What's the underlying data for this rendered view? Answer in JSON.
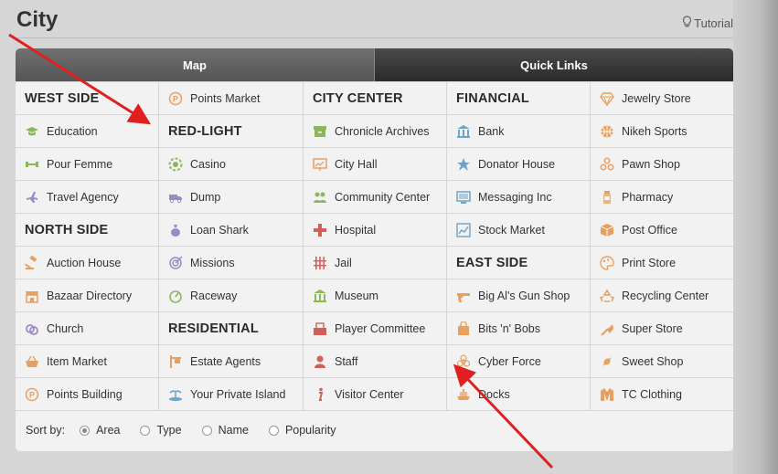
{
  "header": {
    "title": "City",
    "tutorial": "Tutorial"
  },
  "tabs": [
    {
      "label": "Map"
    },
    {
      "label": "Quick Links"
    }
  ],
  "colors": {
    "icon_orange": "#e8a060",
    "icon_green": "#8db85a",
    "icon_blue": "#6fa3c7",
    "icon_purple": "#9b8ac4",
    "icon_red": "#d0605a",
    "arrow": "#e02020"
  },
  "columns": [
    [
      {
        "type": "head",
        "label": "WEST SIDE"
      },
      {
        "type": "link",
        "label": "Education",
        "icon": "graduation-cap-icon",
        "color": "#8db85a"
      },
      {
        "type": "link",
        "label": "Pour Femme",
        "icon": "dumbbell-icon",
        "color": "#8db85a"
      },
      {
        "type": "link",
        "label": "Travel Agency",
        "icon": "airplane-icon",
        "color": "#9b8ac4"
      },
      {
        "type": "head",
        "label": "NORTH SIDE"
      },
      {
        "type": "link",
        "label": "Auction House",
        "icon": "gavel-icon",
        "color": "#e8a060"
      },
      {
        "type": "link",
        "label": "Bazaar Directory",
        "icon": "storefront-icon",
        "color": "#e8a060"
      },
      {
        "type": "link",
        "label": "Church",
        "icon": "rings-icon",
        "color": "#9b8ac4"
      },
      {
        "type": "link",
        "label": "Item Market",
        "icon": "basket-icon",
        "color": "#e8a060"
      },
      {
        "type": "link",
        "label": "Points Building",
        "icon": "points-coin-icon",
        "color": "#e8a060"
      }
    ],
    [
      {
        "type": "link",
        "label": "Points Market",
        "icon": "points-coin-icon",
        "color": "#e8a060"
      },
      {
        "type": "head",
        "label": "RED-LIGHT"
      },
      {
        "type": "link",
        "label": "Casino",
        "icon": "chip-icon",
        "color": "#8db85a"
      },
      {
        "type": "link",
        "label": "Dump",
        "icon": "truck-icon",
        "color": "#9b8ac4"
      },
      {
        "type": "link",
        "label": "Loan Shark",
        "icon": "money-bag-icon",
        "color": "#9b8ac4"
      },
      {
        "type": "link",
        "label": "Missions",
        "icon": "target-icon",
        "color": "#9b8ac4"
      },
      {
        "type": "link",
        "label": "Raceway",
        "icon": "speedometer-icon",
        "color": "#8db85a"
      },
      {
        "type": "head",
        "label": "RESIDENTIAL"
      },
      {
        "type": "link",
        "label": "Estate Agents",
        "icon": "sign-post-icon",
        "color": "#e8a060"
      },
      {
        "type": "link",
        "label": "Your Private Island",
        "icon": "island-icon",
        "color": "#6fa3c7"
      }
    ],
    [
      {
        "type": "head",
        "label": "CITY CENTER"
      },
      {
        "type": "link",
        "label": "Chronicle Archives",
        "icon": "archive-icon",
        "color": "#8db85a"
      },
      {
        "type": "link",
        "label": "City Hall",
        "icon": "chart-board-icon",
        "color": "#e8a060"
      },
      {
        "type": "link",
        "label": "Community Center",
        "icon": "people-icon",
        "color": "#8db85a"
      },
      {
        "type": "link",
        "label": "Hospital",
        "icon": "medical-cross-icon",
        "color": "#d0605a"
      },
      {
        "type": "link",
        "label": "Jail",
        "icon": "bars-icon",
        "color": "#d0605a"
      },
      {
        "type": "link",
        "label": "Museum",
        "icon": "museum-icon",
        "color": "#8db85a"
      },
      {
        "type": "link",
        "label": "Player Committee",
        "icon": "ballot-box-icon",
        "color": "#d0605a"
      },
      {
        "type": "link",
        "label": "Staff",
        "icon": "person-icon",
        "color": "#d0605a"
      },
      {
        "type": "link",
        "label": "Visitor Center",
        "icon": "info-icon",
        "color": "#d0605a"
      }
    ],
    [
      {
        "type": "head",
        "label": "FINANCIAL"
      },
      {
        "type": "link",
        "label": "Bank",
        "icon": "bank-icon",
        "color": "#6fa3c7"
      },
      {
        "type": "link",
        "label": "Donator House",
        "icon": "star-icon",
        "color": "#6fa3c7"
      },
      {
        "type": "link",
        "label": "Messaging Inc",
        "icon": "monitor-icon",
        "color": "#6fa3c7"
      },
      {
        "type": "link",
        "label": "Stock Market",
        "icon": "stock-chart-icon",
        "color": "#6fa3c7"
      },
      {
        "type": "head",
        "label": "EAST SIDE"
      },
      {
        "type": "link",
        "label": "Big Al's Gun Shop",
        "icon": "gun-icon",
        "color": "#e8a060"
      },
      {
        "type": "link",
        "label": "Bits 'n' Bobs",
        "icon": "shopping-bag-icon",
        "color": "#e8a060"
      },
      {
        "type": "link",
        "label": "Cyber Force",
        "icon": "biohazard-icon",
        "color": "#e8a060"
      },
      {
        "type": "link",
        "label": "Docks",
        "icon": "ship-icon",
        "color": "#e8a060"
      }
    ],
    [
      {
        "type": "link",
        "label": "Jewelry Store",
        "icon": "diamond-icon",
        "color": "#e8a060"
      },
      {
        "type": "link",
        "label": "Nikeh Sports",
        "icon": "basketball-icon",
        "color": "#e8a060"
      },
      {
        "type": "link",
        "label": "Pawn Shop",
        "icon": "pawn-balls-icon",
        "color": "#e8a060"
      },
      {
        "type": "link",
        "label": "Pharmacy",
        "icon": "pill-bottle-icon",
        "color": "#e8a060"
      },
      {
        "type": "link",
        "label": "Post Office",
        "icon": "parcel-icon",
        "color": "#e8a060"
      },
      {
        "type": "link",
        "label": "Print Store",
        "icon": "palette-icon",
        "color": "#e8a060"
      },
      {
        "type": "link",
        "label": "Recycling Center",
        "icon": "recycle-icon",
        "color": "#e8a060"
      },
      {
        "type": "link",
        "label": "Super Store",
        "icon": "vacuum-icon",
        "color": "#e8a060"
      },
      {
        "type": "link",
        "label": "Sweet Shop",
        "icon": "candy-icon",
        "color": "#e8a060"
      },
      {
        "type": "link",
        "label": "TC Clothing",
        "icon": "jacket-icon",
        "color": "#e8a060"
      }
    ]
  ],
  "sort": {
    "label": "Sort by:",
    "options": [
      {
        "label": "Area",
        "selected": true
      },
      {
        "label": "Type",
        "selected": false
      },
      {
        "label": "Name",
        "selected": false
      },
      {
        "label": "Popularity",
        "selected": false
      }
    ]
  }
}
